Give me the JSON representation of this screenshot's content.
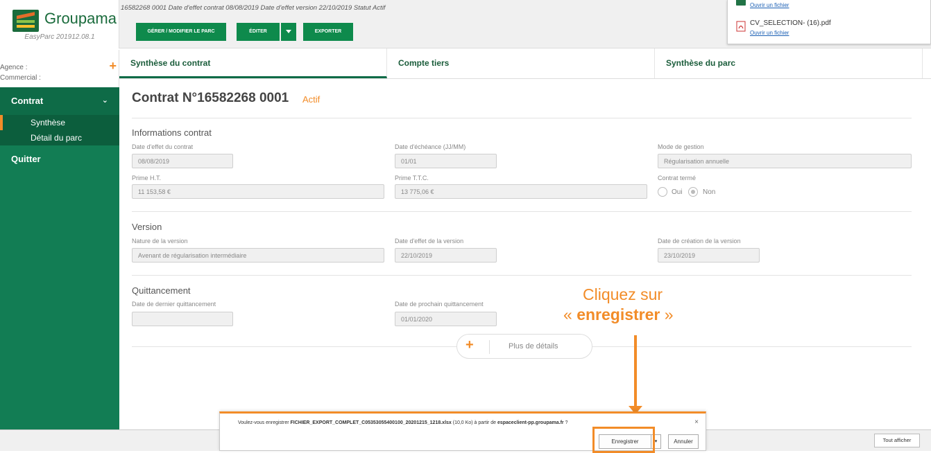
{
  "brand": {
    "name": "Groupama",
    "version": "EasyParc 201912.08.1"
  },
  "agency": {
    "agence_label": "Agence :",
    "commercial_label": "Commercial :"
  },
  "sidebar": {
    "contrat": "Contrat",
    "items": [
      "Synthèse",
      "Détail du parc"
    ],
    "quitter": "Quitter"
  },
  "topbar": {
    "contract_line": "16582268 0001   Date d'effet contrat 08/08/2019   Date d'effet version 22/10/2019   Statut Actif",
    "btn_gerer": "GÉRER / MODIFIER LE PARC",
    "btn_editer": "ÉDITER",
    "btn_exporter": "EXPORTER"
  },
  "files": {
    "open_link": "Ouvrir un fichier",
    "file2_name": "CV_SELECTION- (16).pdf"
  },
  "tabs": [
    "Synthèse du contrat",
    "Compte tiers",
    "Synthèse du parc"
  ],
  "contract": {
    "title": "Contrat N°16582268 0001",
    "status": "Actif"
  },
  "info": {
    "section": "Informations contrat",
    "date_effet_label": "Date d'effet du contrat",
    "date_effet": "08/08/2019",
    "echeance_label": "Date d'échéance (JJ/MM)",
    "echeance": "01/01",
    "gestion_label": "Mode de gestion",
    "gestion": "Régularisation annuelle",
    "prime_ht_label": "Prime H.T.",
    "prime_ht": "11 153,58 €",
    "prime_ttc_label": "Prime T.T.C.",
    "prime_ttc": "13 775,06 €",
    "terme_label": "Contrat termé",
    "oui": "Oui",
    "non": "Non"
  },
  "version": {
    "section": "Version",
    "nature_label": "Nature de la version",
    "nature": "Avenant de régularisation intermédiaire",
    "effet_label": "Date d'effet de la version",
    "effet": "22/10/2019",
    "creation_label": "Date de création de la version",
    "creation": "23/10/2019"
  },
  "quittancement": {
    "section": "Quittancement",
    "dernier_label": "Date de dernier quittancement",
    "dernier": "",
    "prochain_label": "Date de prochain quittancement",
    "prochain": "01/01/2020"
  },
  "more": "Plus de détails",
  "annotation": {
    "line1": "Cliquez sur",
    "line2_pre": "« ",
    "line2_bold": "enregistrer",
    "line2_post": " »"
  },
  "dialog": {
    "msg_pre": "Voulez-vous enregistrer ",
    "file": "FICHIER_EXPORT_COMPLET_C05353055400100_20201215_1218.xlsx",
    "msg_mid": " (10,0 Ko) à partir de ",
    "site": "espaceclient-pp.groupama.fr",
    "msg_post": " ?",
    "save": "Enregistrer",
    "cancel": "Annuler"
  },
  "show_all": "Tout afficher"
}
